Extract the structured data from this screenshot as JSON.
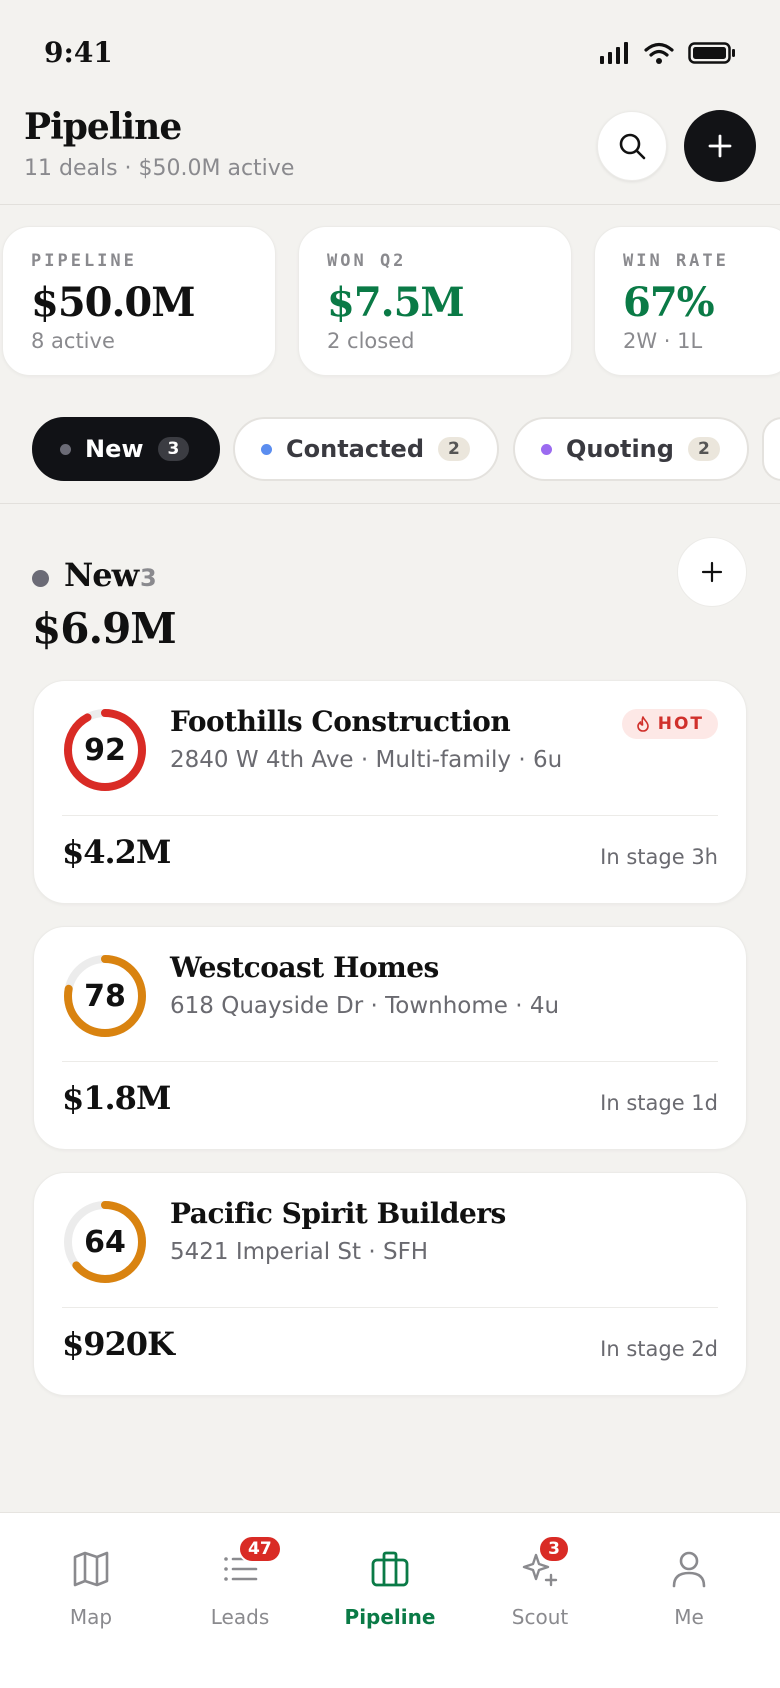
{
  "status_bar": {
    "time": "9:41"
  },
  "header": {
    "title": "Pipeline",
    "subtitle": "11 deals · $50.0M active"
  },
  "stats": [
    {
      "label": "PIPELINE",
      "value": "$50.0M",
      "sub": "8 active",
      "accent": "#111111"
    },
    {
      "label": "WON Q2",
      "value": "$7.5M",
      "sub": "2 closed",
      "accent": "#0a7a46"
    },
    {
      "label": "WIN RATE",
      "value": "67%",
      "sub": "2W · 1L",
      "accent": "#0a7a46"
    }
  ],
  "stage_chips": [
    {
      "label": "New",
      "count": "3",
      "dot_color": "#6b6b76",
      "active": true
    },
    {
      "label": "Contacted",
      "count": "2",
      "dot_color": "#5b8def",
      "active": false
    },
    {
      "label": "Quoting",
      "count": "2",
      "dot_color": "#9b6bf0",
      "active": false
    }
  ],
  "section": {
    "name": "New",
    "count": "3",
    "total": "$6.9M"
  },
  "deals": [
    {
      "score": "92",
      "score_fraction": 0.92,
      "ring_color": "#d92b25",
      "name": "Foothills Construction",
      "address": "2840 W 4th Ave · Multi-family · 6u",
      "badge": "HOT",
      "value": "$4.2M",
      "stage_time": "In stage 3h"
    },
    {
      "score": "78",
      "score_fraction": 0.78,
      "ring_color": "#d98310",
      "name": "Westcoast Homes",
      "address": "618 Quayside Dr · Townhome · 4u",
      "badge": "",
      "value": "$1.8M",
      "stage_time": "In stage 1d"
    },
    {
      "score": "64",
      "score_fraction": 0.64,
      "ring_color": "#d98310",
      "name": "Pacific Spirit Builders",
      "address": "5421 Imperial St · SFH",
      "badge": "",
      "value": "$920K",
      "stage_time": "In stage 2d"
    }
  ],
  "bottom_nav": [
    {
      "label": "Map",
      "icon": "map-icon",
      "badge": "",
      "active": false
    },
    {
      "label": "Leads",
      "icon": "list-icon",
      "badge": "47",
      "active": false
    },
    {
      "label": "Pipeline",
      "icon": "briefcase-icon",
      "badge": "",
      "active": true
    },
    {
      "label": "Scout",
      "icon": "sparkle-icon",
      "badge": "3",
      "active": false
    },
    {
      "label": "Me",
      "icon": "person-icon",
      "badge": "",
      "active": false
    }
  ],
  "colors": {
    "active_green": "#0a7a46",
    "hot_red": "#d92b25",
    "background": "#f3f2ef"
  }
}
